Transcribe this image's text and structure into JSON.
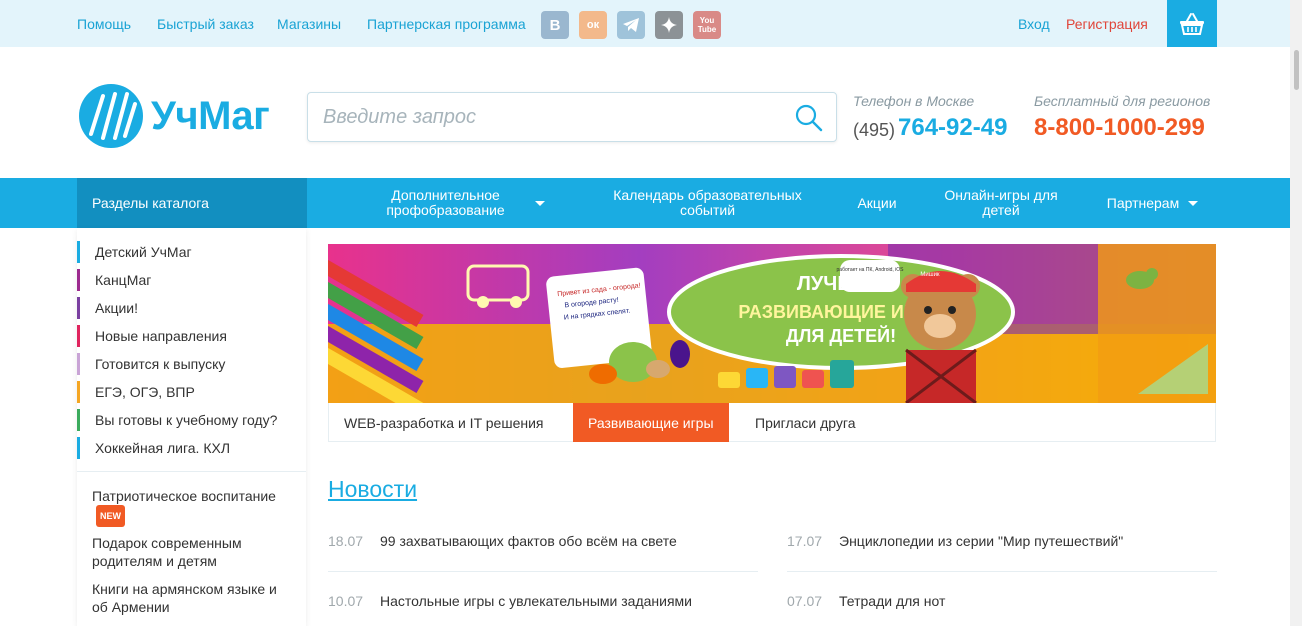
{
  "topbar": {
    "links": [
      "Помощь",
      "Быстрый заказ",
      "Магазины",
      "Партнерская программа"
    ],
    "social": [
      {
        "name": "vk-icon",
        "label": "В",
        "color": "#9ab7cf"
      },
      {
        "name": "odnoklassniki-icon",
        "label": "ок",
        "color": "#f3b98b"
      },
      {
        "name": "telegram-icon",
        "label": "",
        "color": "#9fc3da"
      },
      {
        "name": "star-icon",
        "label": "",
        "color": "#8c9296"
      },
      {
        "name": "youtube-icon",
        "label": "You Tube",
        "color": "#d98a87"
      }
    ],
    "login": "Вход",
    "register": "Регистрация"
  },
  "header": {
    "logo_text": "УчМаг",
    "search_placeholder": "Введите запрос",
    "moscow_label": "Телефон в Москве",
    "moscow_code": "(495)",
    "moscow_number": "764-92-49",
    "regions_label": "Бесплатный для регионов",
    "regions_number": "8-800-1000-299"
  },
  "nav": {
    "catalog": "Разделы каталога",
    "items": [
      "Дополнительное профобразование",
      "Календарь образовательных событий",
      "Акции",
      "Онлайн-игры для детей",
      "Партнерам"
    ]
  },
  "sidebar": {
    "items": [
      {
        "label": "Детский УчМаг",
        "color": "#1aace2"
      },
      {
        "label": "КанцМаг",
        "color": "#9c2a8e"
      },
      {
        "label": "Акции!",
        "color": "#7a3fa0"
      },
      {
        "label": "Новые направления",
        "color": "#e0245e"
      },
      {
        "label": "Готовится к выпуску",
        "color": "#c9a4d6"
      },
      {
        "label": "ЕГЭ, ОГЭ, ВПР",
        "color": "#f5a623"
      },
      {
        "label": "Вы готовы к учебному году?",
        "color": "#3aaa5c"
      },
      {
        "label": "Хоккейная лига. КХЛ",
        "color": "#1aace2"
      }
    ],
    "extra": [
      {
        "label": "Патриотическое воспитание",
        "badge": "NEW"
      },
      {
        "label": "Подарок современным родителям и детям"
      },
      {
        "label": "Книги на армянском языке и об Армении"
      }
    ]
  },
  "banner": {
    "headline_1": "ЛУЧШИЕ",
    "headline_2": "РАЗВИВАЮЩИЕ ИГРЫ",
    "headline_3": "ДЛЯ ДЕТЕЙ!",
    "card_text": "Привет из сада - огорода! В огороде расту! И на грядках спелят. Овощ...",
    "platforms": "работает на ПК, Android, iOS",
    "bear_cap": "Мишик"
  },
  "tabs": [
    "WEB-разработка и IT решения",
    "Развивающие игры",
    "Пригласи друга"
  ],
  "news": {
    "title": "Новости",
    "items": [
      {
        "date": "18.07",
        "text": "99 захватывающих фактов обо всём на свете"
      },
      {
        "date": "17.07",
        "text": "Энциклопедии из серии \"Мир путешествий\""
      },
      {
        "date": "10.07",
        "text": "Настольные игры с увлекательными заданиями"
      },
      {
        "date": "07.07",
        "text": "Тетради для нот"
      }
    ]
  }
}
